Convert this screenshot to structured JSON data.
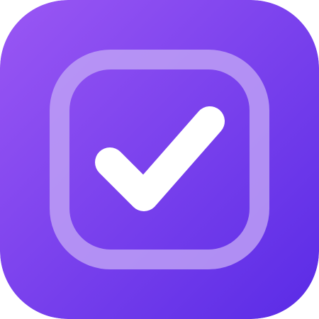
{
  "app_icon": {
    "icon": "checkbox-checked-icon",
    "state": "checked",
    "colors": {
      "background_top_left": "#9A57F4",
      "background_bottom_right": "#5A2BE6",
      "checkbox_outline": "#BFA2F5",
      "checkmark": "#FFFFFF"
    }
  }
}
